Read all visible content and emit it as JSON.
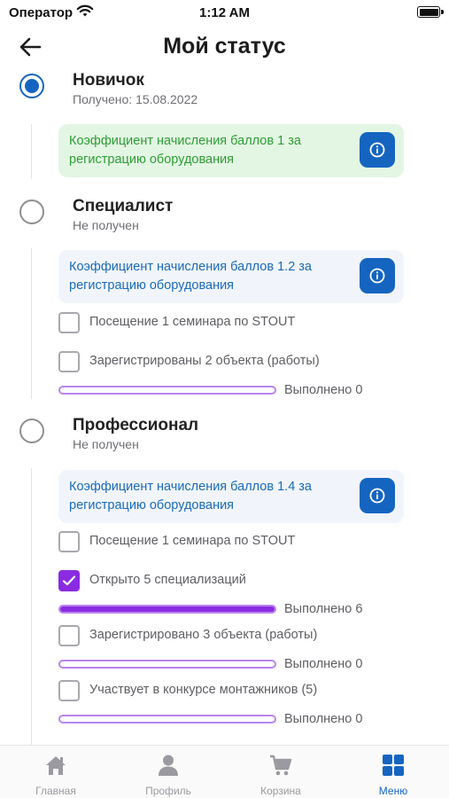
{
  "status_bar": {
    "carrier": "Оператор",
    "time": "1:12 AM"
  },
  "header": {
    "title": "Мой статус"
  },
  "levels": [
    {
      "title": "Новичок",
      "status": "Получено: 15.08.2022",
      "achieved": true,
      "coefficient": "Коэффициент начисления баллов 1 за регистрацию оборудования"
    },
    {
      "title": "Специалист",
      "status": "Не получен",
      "achieved": false,
      "coefficient": "Коэффициент начисления баллов 1.2 за регистрацию оборудования",
      "requirements": [
        {
          "label": "Посещение 1 семинара по STOUT",
          "checked": false
        },
        {
          "label": "Зарегистрированы 2 объекта (работы)",
          "checked": false,
          "progress_label": "Выполнено 0",
          "progress": 0
        }
      ]
    },
    {
      "title": "Профессионал",
      "status": "Не получен",
      "achieved": false,
      "coefficient": "Коэффициент начисления баллов 1.4 за регистрацию оборудования",
      "requirements": [
        {
          "label": "Посещение 1 семинара по STOUT",
          "checked": false
        },
        {
          "label": "Открыто 5 специализаций",
          "checked": true,
          "progress_label": "Выполнено 6",
          "progress": 1.0
        },
        {
          "label": "Зарегистрировано 3 объекта (работы)",
          "checked": false,
          "progress_label": "Выполнено 0",
          "progress": 0
        },
        {
          "label": "Участвует в конкурсе монтажников (5)",
          "checked": false,
          "progress_label": "Выполнено 0",
          "progress": 0
        }
      ]
    }
  ],
  "tabbar": {
    "items": [
      {
        "label": "Главная",
        "icon": "home-icon",
        "active": false
      },
      {
        "label": "Профиль",
        "icon": "profile-icon",
        "active": false
      },
      {
        "label": "Корзина",
        "icon": "cart-icon",
        "active": false
      },
      {
        "label": "Меню",
        "icon": "menu-grid-icon",
        "active": true
      }
    ]
  },
  "colors": {
    "primary": "#1565c0",
    "accent_purple": "#8a2be2",
    "achieved_green": "#2e9d34",
    "inactive_gray": "#9a9aa0"
  }
}
